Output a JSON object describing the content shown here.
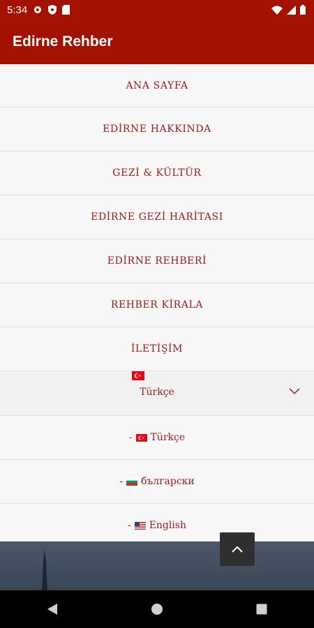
{
  "status_bar": {
    "time": "5:34",
    "icons": [
      "gear-icon",
      "shield-icon",
      "sd-card-icon",
      "wifi-icon",
      "signal-icon",
      "battery-icon"
    ]
  },
  "app_bar": {
    "title": "Edirne Rehber"
  },
  "menu": {
    "items": [
      {
        "label": "ANA SAYFA"
      },
      {
        "label": "EDİRNE HAKKINDA"
      },
      {
        "label": "GEZİ & KÜLTÜR"
      },
      {
        "label": "EDİRNE GEZİ HARİTASI"
      },
      {
        "label": "EDİRNE REHBERİ"
      },
      {
        "label": "REHBER KİRALA"
      },
      {
        "label": "İLETİŞİM"
      }
    ]
  },
  "language": {
    "current": "Türkçe",
    "options": [
      {
        "prefix": "-",
        "label": "Türkçe",
        "flag": "turkey-flag-icon"
      },
      {
        "prefix": "-",
        "label": "български",
        "flag": "bulgaria-flag-icon"
      },
      {
        "prefix": "-",
        "label": "English",
        "flag": "usa-flag-icon"
      }
    ]
  },
  "colors": {
    "primary": "#a31100",
    "menu_text": "#9b1a1a"
  }
}
